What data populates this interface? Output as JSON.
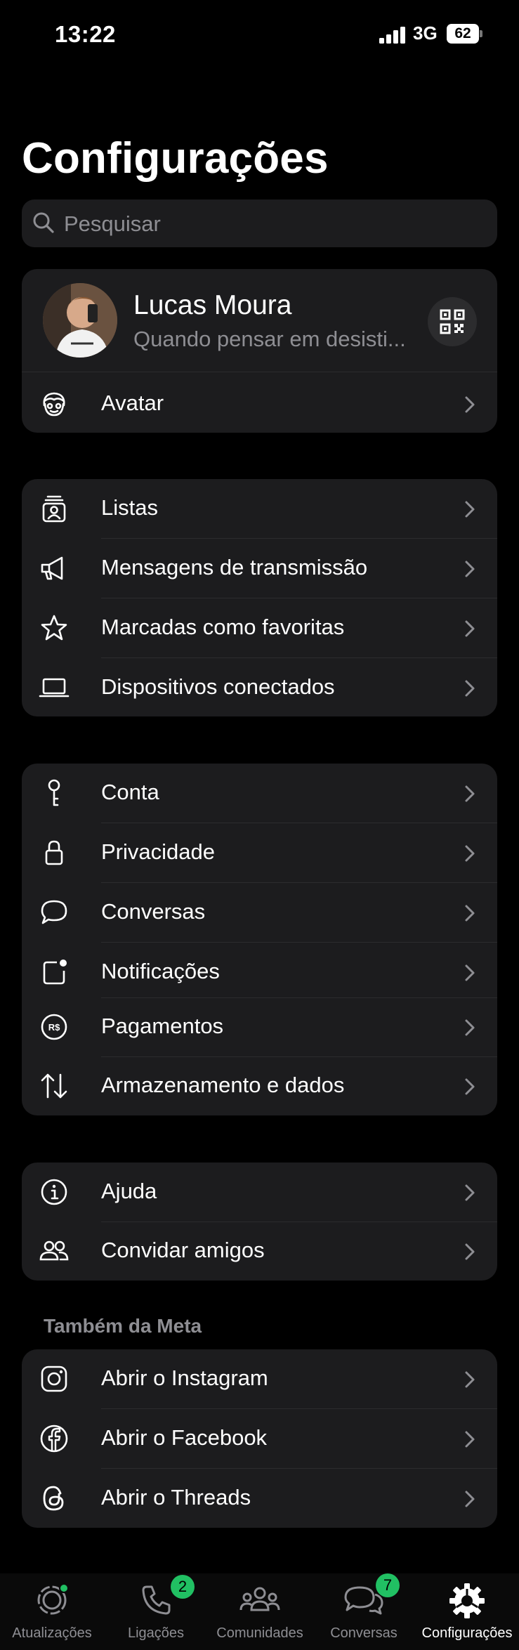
{
  "status_bar": {
    "time": "13:22",
    "network": "3G",
    "battery": "62"
  },
  "page_title": "Configurações",
  "search": {
    "placeholder": "Pesquisar"
  },
  "profile": {
    "name": "Lucas Moura",
    "status": "Quando pensar em desisti...",
    "avatar_row_label": "Avatar"
  },
  "group1": [
    {
      "label": "Listas",
      "icon": "contact-list-icon"
    },
    {
      "label": "Mensagens de transmissão",
      "icon": "megaphone-icon"
    },
    {
      "label": "Marcadas como favoritas",
      "icon": "star-icon"
    },
    {
      "label": "Dispositivos conectados",
      "icon": "laptop-icon"
    }
  ],
  "group2": [
    {
      "label": "Conta",
      "icon": "key-icon"
    },
    {
      "label": "Privacidade",
      "icon": "lock-icon"
    },
    {
      "label": "Conversas",
      "icon": "chat-bubble-icon"
    },
    {
      "label": "Notificações",
      "icon": "notification-icon"
    },
    {
      "label": "Pagamentos",
      "icon": "payment-icon"
    },
    {
      "label": "Armazenamento e dados",
      "icon": "arrows-updown-icon"
    }
  ],
  "group3": [
    {
      "label": "Ajuda",
      "icon": "info-icon"
    },
    {
      "label": "Convidar amigos",
      "icon": "people-icon"
    }
  ],
  "meta_section": {
    "header": "Também da Meta",
    "items": [
      {
        "label": "Abrir o Instagram",
        "icon": "instagram-icon"
      },
      {
        "label": "Abrir o Facebook",
        "icon": "facebook-icon"
      },
      {
        "label": "Abrir o Threads",
        "icon": "threads-icon"
      }
    ]
  },
  "tabs": [
    {
      "label": "Atualizações",
      "icon": "updates-icon",
      "dot": true
    },
    {
      "label": "Ligações",
      "icon": "phone-icon",
      "badge": "2"
    },
    {
      "label": "Comunidades",
      "icon": "communities-icon"
    },
    {
      "label": "Conversas",
      "icon": "chats-icon",
      "badge": "7"
    },
    {
      "label": "Configurações",
      "icon": "settings-gear-icon",
      "active": true
    }
  ],
  "colors": {
    "accent": "#21c063",
    "card": "#1c1c1e",
    "secondary_text": "#8e8e93"
  }
}
